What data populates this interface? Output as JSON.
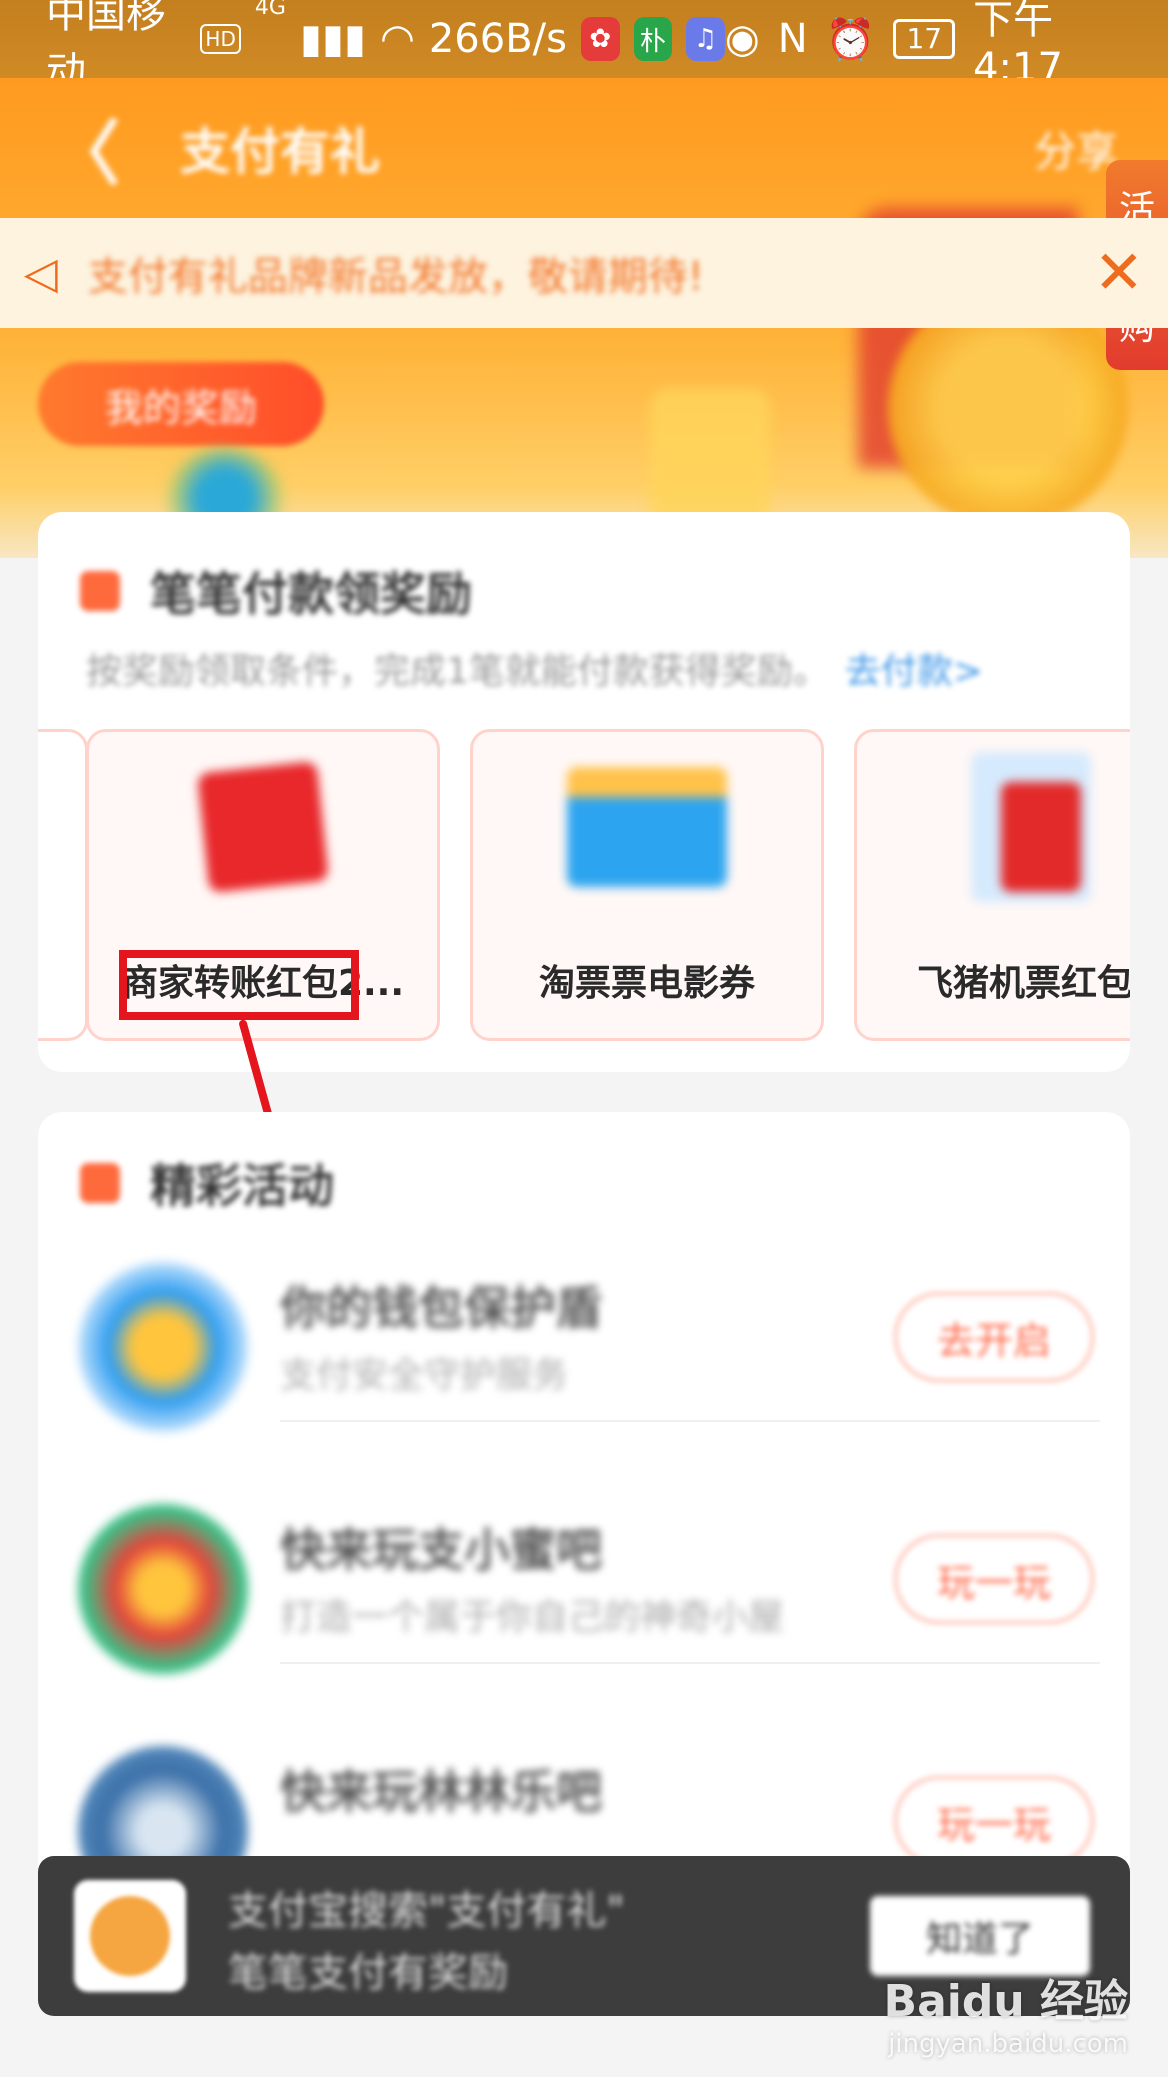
{
  "status_bar": {
    "carrier": "中国移动",
    "hd": "HD",
    "network": "4G",
    "speed": "266B/s",
    "app1": "✿",
    "app2": "朴",
    "app3": "♫",
    "battery": "17",
    "time": "下午4:17"
  },
  "header": {
    "back": "〈",
    "title": "支付有礼",
    "share": "分享",
    "side_tag_top": "活",
    "side_tag_bottom": "购"
  },
  "notice": {
    "text": "支付有礼品牌新品发放，敬请期待!",
    "close": "✕"
  },
  "my_reward_button": "我的奖励",
  "reward_card": {
    "title": "笔笔付款领奖励",
    "subtitle": "按奖励领取条件，完成1笔就能付款获得奖励。",
    "subtitle_link": "去付款>",
    "items": [
      {
        "label": "商家转账红包2..."
      },
      {
        "label": "淘票票电影券"
      },
      {
        "label": "飞猪机票红包"
      }
    ]
  },
  "activity_card": {
    "title": "精彩活动",
    "items": [
      {
        "title": "你的钱包保护盾",
        "desc": "支付安全守护服务",
        "button": "去开启",
        "icon_color": "#2e9df0"
      },
      {
        "title": "快来玩支小蜜吧",
        "desc": "打造一个属于你自己的神奇小屋",
        "button": "玩一玩",
        "icon_color": "#3dbf86"
      },
      {
        "title": "快来玩林林乐吧",
        "desc": "",
        "button": "玩一玩",
        "icon_color": "#3a6fa8"
      }
    ]
  },
  "toast": {
    "line1": "支付宝搜索\"支付有礼\"",
    "line2": "笔笔支付有奖励",
    "button": "知道了"
  },
  "watermark": {
    "main": "Baidu 经验",
    "sub": "jingyan.baidu.com"
  }
}
